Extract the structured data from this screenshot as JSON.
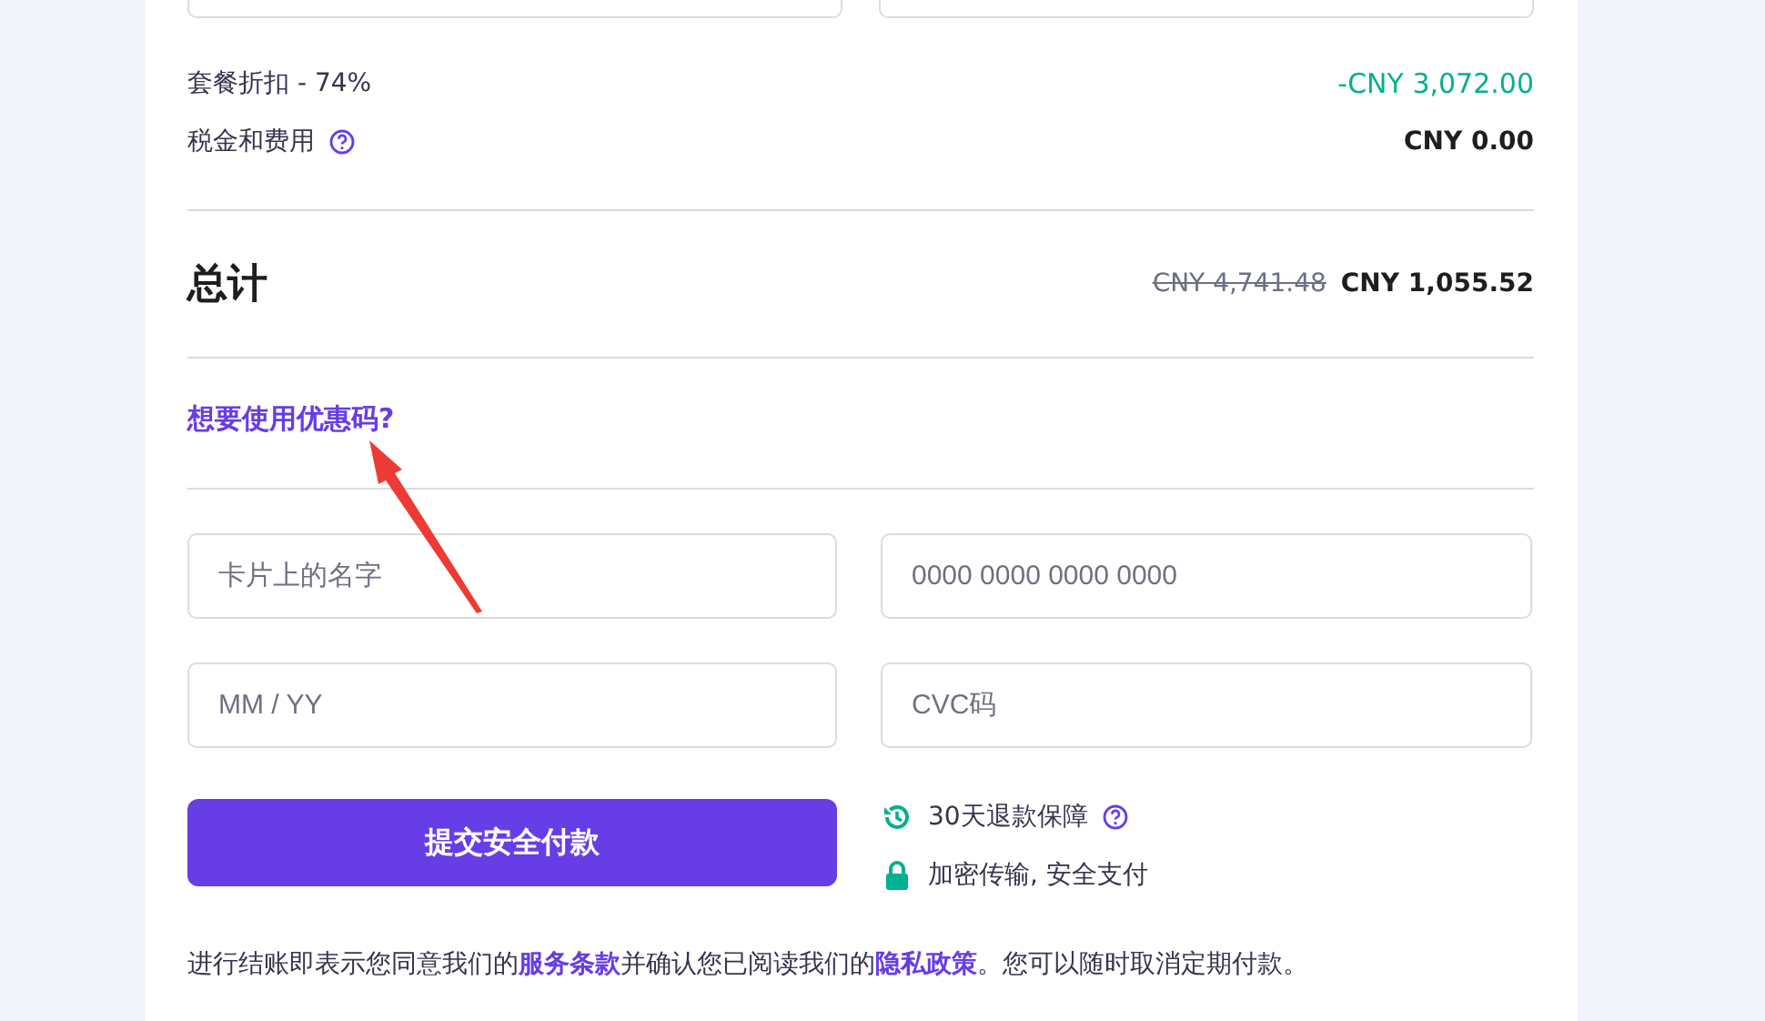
{
  "cut_fields": [
    {
      "kind": "field"
    },
    {
      "kind": "field"
    }
  ],
  "summary_rows": [
    {
      "label": "套餐折扣 - 74%",
      "help": false,
      "amount": "-CNY 3,072.00",
      "kind": "discount"
    },
    {
      "label": "税金和费用",
      "help": true,
      "amount": "CNY 0.00",
      "kind": "plain"
    }
  ],
  "total": {
    "label": "总计",
    "old_price": "CNY 4,741.48",
    "price": "CNY 1,055.52"
  },
  "coupon_link": "想要使用优惠码?",
  "card_fields": [
    {
      "placeholder": "卡片上的名字"
    },
    {
      "placeholder": "0000 0000 0000 0000"
    },
    {
      "placeholder": "MM / YY"
    },
    {
      "placeholder": "CVC码"
    }
  ],
  "submit_button": "提交安全付款",
  "guarantees": [
    {
      "kind": "refund",
      "text": "30天退款保障",
      "help": true
    },
    {
      "kind": "secure",
      "text": "加密传输, 安全支付",
      "help": false
    }
  ],
  "terms": [
    {
      "kind": "text",
      "text": "进行结账即表示您同意我们的"
    },
    {
      "kind": "link",
      "text": "服务条款"
    },
    {
      "kind": "text",
      "text": "并确认您已阅读我们的"
    },
    {
      "kind": "link",
      "text": "隐私政策"
    },
    {
      "kind": "text",
      "text": "。您可以随时取消定期付款。"
    }
  ]
}
